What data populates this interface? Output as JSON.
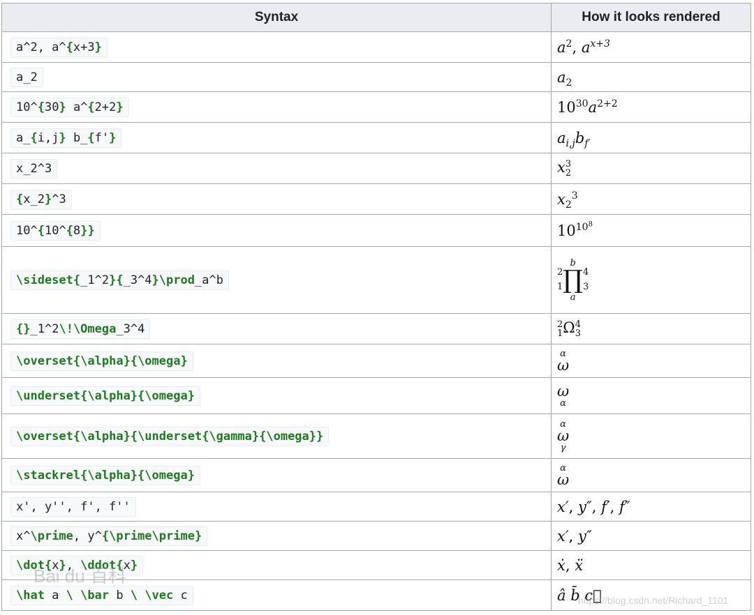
{
  "header": {
    "syntax": "Syntax",
    "rendered": "How it looks rendered"
  },
  "rows": [
    {
      "syntax": "a^2, a^{x+3}",
      "rendered": "a2, ax+3"
    },
    {
      "syntax": "a_2",
      "rendered": "a2"
    },
    {
      "syntax": "10^{30} a^{2+2}",
      "rendered": "1030a2+2"
    },
    {
      "syntax": "a_{i,j} b_{f'}",
      "rendered": "ai,jbf′"
    },
    {
      "syntax": "x_2^3",
      "rendered": "x23"
    },
    {
      "syntax": "{x_2}^3",
      "rendered": "x23"
    },
    {
      "syntax": "10^{10^{8}}",
      "rendered": "10108"
    },
    {
      "syntax": "\\sideset{_1^2}{_3^4}\\prod_a^b",
      "rendered": "21∏ab43"
    },
    {
      "syntax": "{}_1^2\\!\\Omega_3^4",
      "rendered": "21Ω34"
    },
    {
      "syntax": "\\overset{\\alpha}{\\omega}",
      "rendered": "αω"
    },
    {
      "syntax": "\\underset{\\alpha}{\\omega}",
      "rendered": "ωα"
    },
    {
      "syntax": "\\overset{\\alpha}{\\underset{\\gamma}{\\omega}}",
      "rendered": "αωγ"
    },
    {
      "syntax": "\\stackrel{\\alpha}{\\omega}",
      "rendered": "αω"
    },
    {
      "syntax": "x', y'', f', f''",
      "rendered": "x′, y″, f′, f″"
    },
    {
      "syntax": "x^\\prime, y^{\\prime\\prime}",
      "rendered": "x′, y″"
    },
    {
      "syntax": "\\dot{x}, \\ddot{x}",
      "rendered": "ẋ, ẍ"
    },
    {
      "syntax": "\\hat a \\ \\bar b \\ \\vec c",
      "rendered": "â b̄ c⃗"
    }
  ],
  "watermarks": {
    "left": "Bai du 百科",
    "right": "https://blog.csdn.net/Richard_1101"
  }
}
